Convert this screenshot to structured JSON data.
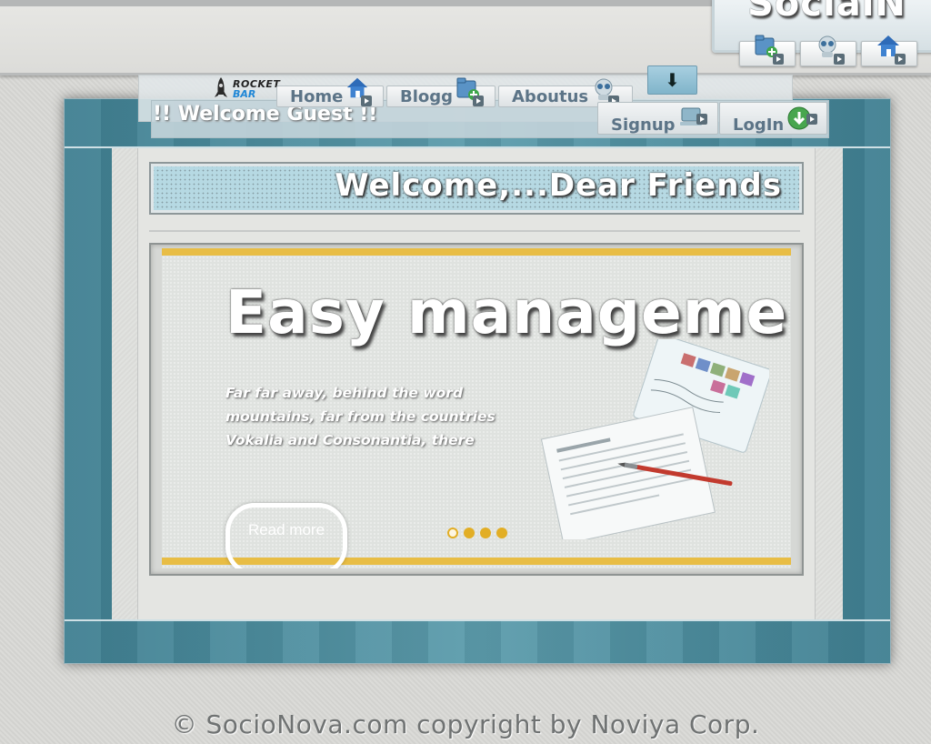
{
  "brand": {
    "name": "SocialN"
  },
  "brand_icons": [
    {
      "name": "add-folder-icon"
    },
    {
      "name": "robot-icon"
    },
    {
      "name": "home-icon"
    }
  ],
  "logo": {
    "line1": "ROCKET",
    "line2": "BAR"
  },
  "nav": {
    "tabs": [
      {
        "label": "Home",
        "icon": "home-icon"
      },
      {
        "label": "Blogg",
        "icon": "add-folder-icon"
      },
      {
        "label": "Aboutus",
        "icon": "robot-icon"
      }
    ],
    "down_arrow": "⬇",
    "greeting": "!! Welcome Guest !!",
    "signup_label": "Signup",
    "login_label": "LogIn"
  },
  "banner": {
    "title": "Welcome,...Dear Friends"
  },
  "slider": {
    "title": "Easy management",
    "body": "Far far away, behind the word mountains, far from the countries Vokalia and Consonantia, there",
    "cta_label": "Read more",
    "dots_total": 4,
    "active_dot": 1
  },
  "footer": {
    "text": "© SocioNova.com copyright by Noviya Corp."
  },
  "colors": {
    "frame_teal": "#4a8a9b",
    "accent_gold": "#e8bd45",
    "nav_text": "#5c7487",
    "banner_bg": "#b6d9e3"
  }
}
